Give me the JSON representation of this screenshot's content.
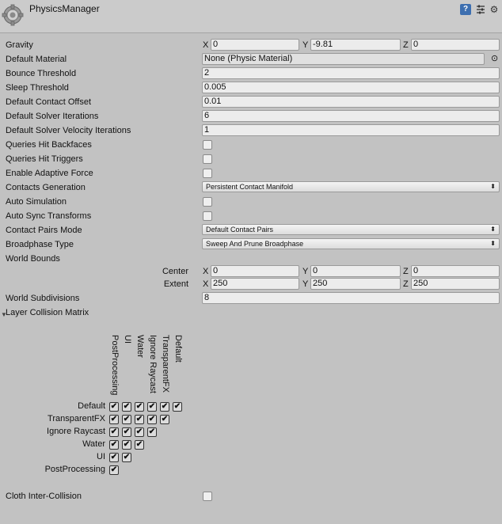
{
  "header": {
    "title": "PhysicsManager",
    "help_icon": "?",
    "settings_icon": "⚙"
  },
  "rows": {
    "gravity": {
      "label": "Gravity",
      "x": "0",
      "y": "-9.81",
      "z": "0"
    },
    "default_material": {
      "label": "Default Material",
      "value": "None (Physic Material)"
    },
    "bounce_threshold": {
      "label": "Bounce Threshold",
      "value": "2"
    },
    "sleep_threshold": {
      "label": "Sleep Threshold",
      "value": "0.005"
    },
    "default_contact_offset": {
      "label": "Default Contact Offset",
      "value": "0.01"
    },
    "default_solver_iterations": {
      "label": "Default Solver Iterations",
      "value": "6"
    },
    "default_solver_velocity_iterations": {
      "label": "Default Solver Velocity Iterations",
      "value": "1"
    },
    "queries_hit_backfaces": {
      "label": "Queries Hit Backfaces",
      "checked": false
    },
    "queries_hit_triggers": {
      "label": "Queries Hit Triggers",
      "checked": false
    },
    "enable_adaptive_force": {
      "label": "Enable Adaptive Force",
      "checked": false
    },
    "contacts_generation": {
      "label": "Contacts Generation",
      "value": "Persistent Contact Manifold"
    },
    "auto_simulation": {
      "label": "Auto Simulation",
      "checked": false
    },
    "auto_sync_transforms": {
      "label": "Auto Sync Transforms",
      "checked": false
    },
    "contact_pairs_mode": {
      "label": "Contact Pairs Mode",
      "value": "Default Contact Pairs"
    },
    "broadphase_type": {
      "label": "Broadphase Type",
      "value": "Sweep And Prune Broadphase"
    },
    "world_bounds": {
      "label": "World Bounds",
      "center": {
        "label": "Center",
        "x": "0",
        "y": "0",
        "z": "0"
      },
      "extent": {
        "label": "Extent",
        "x": "250",
        "y": "250",
        "z": "250"
      }
    },
    "world_subdivisions": {
      "label": "World Subdivisions",
      "value": "8"
    },
    "layer_collision_matrix": {
      "label": "Layer Collision Matrix",
      "rows": [
        "Default",
        "TransparentFX",
        "Ignore Raycast",
        "Water",
        "UI",
        "PostProcessing"
      ],
      "columns": [
        "PostProcessing",
        "UI",
        "Water",
        "Ignore Raycast",
        "TransparentFX",
        "Default"
      ]
    },
    "cloth_inter_collision": {
      "label": "Cloth Inter-Collision",
      "checked": false
    }
  },
  "axis": {
    "x": "X",
    "y": "Y",
    "z": "Z"
  },
  "icons": {
    "check_glyph": "✔",
    "dropdown_arrow": "⬍",
    "target_icon": "⊙",
    "foldout_icon": "▼"
  }
}
